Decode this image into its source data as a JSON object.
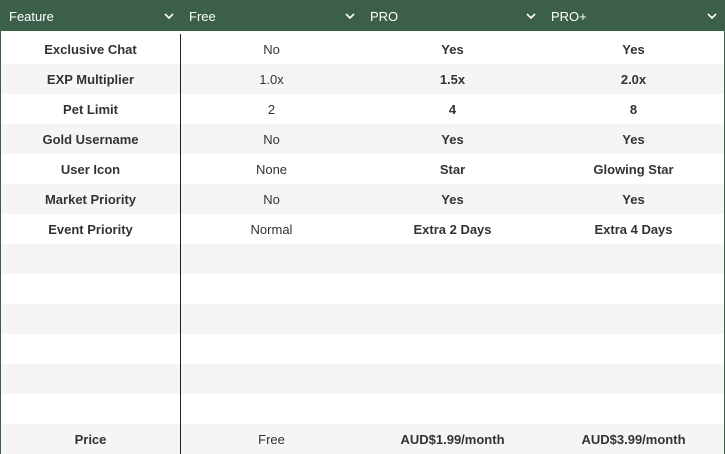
{
  "columns": [
    {
      "label": "Feature"
    },
    {
      "label": "Free"
    },
    {
      "label": "PRO"
    },
    {
      "label": "PRO+"
    }
  ],
  "rows": [
    [
      "Exclusive Chat",
      "No",
      "Yes",
      "Yes"
    ],
    [
      "EXP Multiplier",
      "1.0x",
      "1.5x",
      "2.0x"
    ],
    [
      "Pet Limit",
      "2",
      "4",
      "8"
    ],
    [
      "Gold Username",
      "No",
      "Yes",
      "Yes"
    ],
    [
      "User Icon",
      "None",
      "Star",
      "Glowing Star"
    ],
    [
      "Market Priority",
      "No",
      "Yes",
      "Yes"
    ],
    [
      "Event Priority",
      "Normal",
      "Extra 2 Days",
      "Extra 4 Days"
    ],
    [
      "",
      "",
      "",
      ""
    ],
    [
      "",
      "",
      "",
      ""
    ],
    [
      "",
      "",
      "",
      ""
    ],
    [
      "",
      "",
      "",
      ""
    ],
    [
      "",
      "",
      "",
      ""
    ],
    [
      "",
      "",
      "",
      ""
    ],
    [
      "Price",
      "Free",
      "AUD$1.99/month",
      "AUD$3.99/month"
    ]
  ],
  "colors": {
    "header_bg": "#3c5f4a",
    "header_text": "#ffffff",
    "row_alt": "#f5f5f5"
  },
  "icons": {
    "sort": "chevron-down-icon"
  }
}
